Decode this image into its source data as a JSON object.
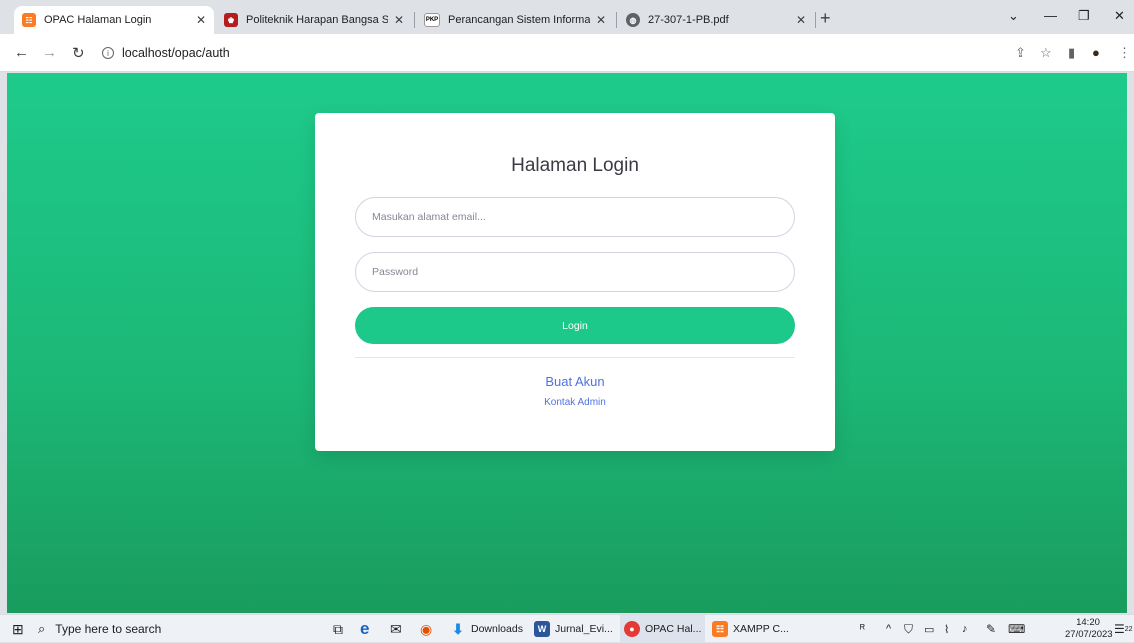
{
  "browser": {
    "tabs": [
      {
        "title": "OPAC Halaman Login",
        "favicon": "xampp-icon",
        "color": "#fb7a24"
      },
      {
        "title": "Politeknik Harapan Bangsa Surak",
        "favicon": "college-icon",
        "color": "#b71c1c"
      },
      {
        "title": "Perancangan Sistem Informasi Pe",
        "favicon": "pkp-icon",
        "color": "#ffffff"
      },
      {
        "title": "27-307-1-PB.pdf",
        "favicon": "globe-icon",
        "color": "#5f6368"
      }
    ],
    "address": "localhost/opac/auth"
  },
  "page": {
    "title": "Halaman Login",
    "email_placeholder": "Masukan alamat email...",
    "password_placeholder": "Password",
    "login_label": "Login",
    "register_link": "Buat Akun",
    "contact_link": "Kontak Admin",
    "accent": "#1cc88a",
    "link_color": "#4e73df"
  },
  "taskbar": {
    "search_placeholder": "Type here to search",
    "items": [
      {
        "label": "Downloads"
      },
      {
        "label": "Jurnal_Evi..."
      },
      {
        "label": "OPAC Hal..."
      },
      {
        "label": "XAMPP C..."
      }
    ],
    "time": "14:20",
    "date": "27/07/2023",
    "notifications": "22"
  }
}
